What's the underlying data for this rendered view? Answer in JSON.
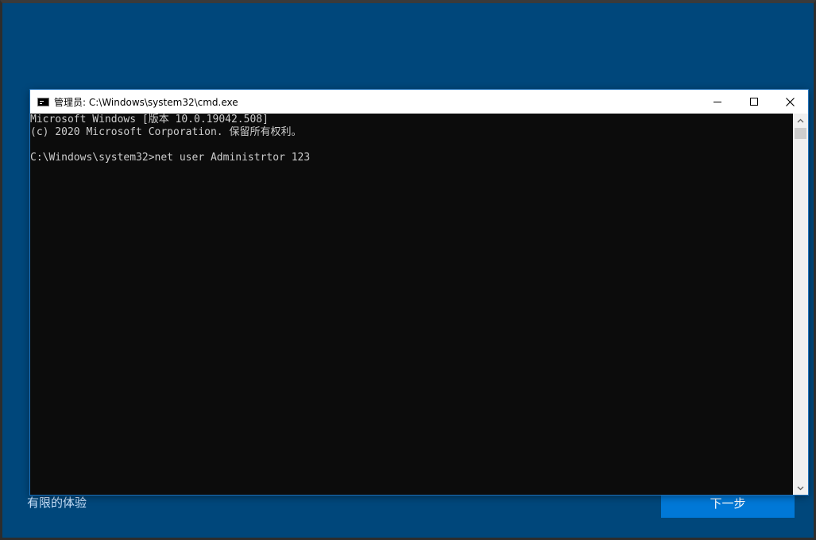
{
  "window": {
    "title": "管理员: C:\\Windows\\system32\\cmd.exe",
    "icon": "cmd-icon"
  },
  "console": {
    "lines": [
      "Microsoft Windows [版本 10.0.19042.508]",
      "(c) 2020 Microsoft Corporation. 保留所有权利。",
      "",
      "C:\\Windows\\system32>net user Administrtor 123"
    ]
  },
  "background": {
    "link_text": "有限的体验",
    "next_button_label": "下一步"
  },
  "colors": {
    "background": "#00477b",
    "console_bg": "#0c0c0c",
    "console_fg": "#cccccc",
    "accent_button": "#0078d7"
  }
}
